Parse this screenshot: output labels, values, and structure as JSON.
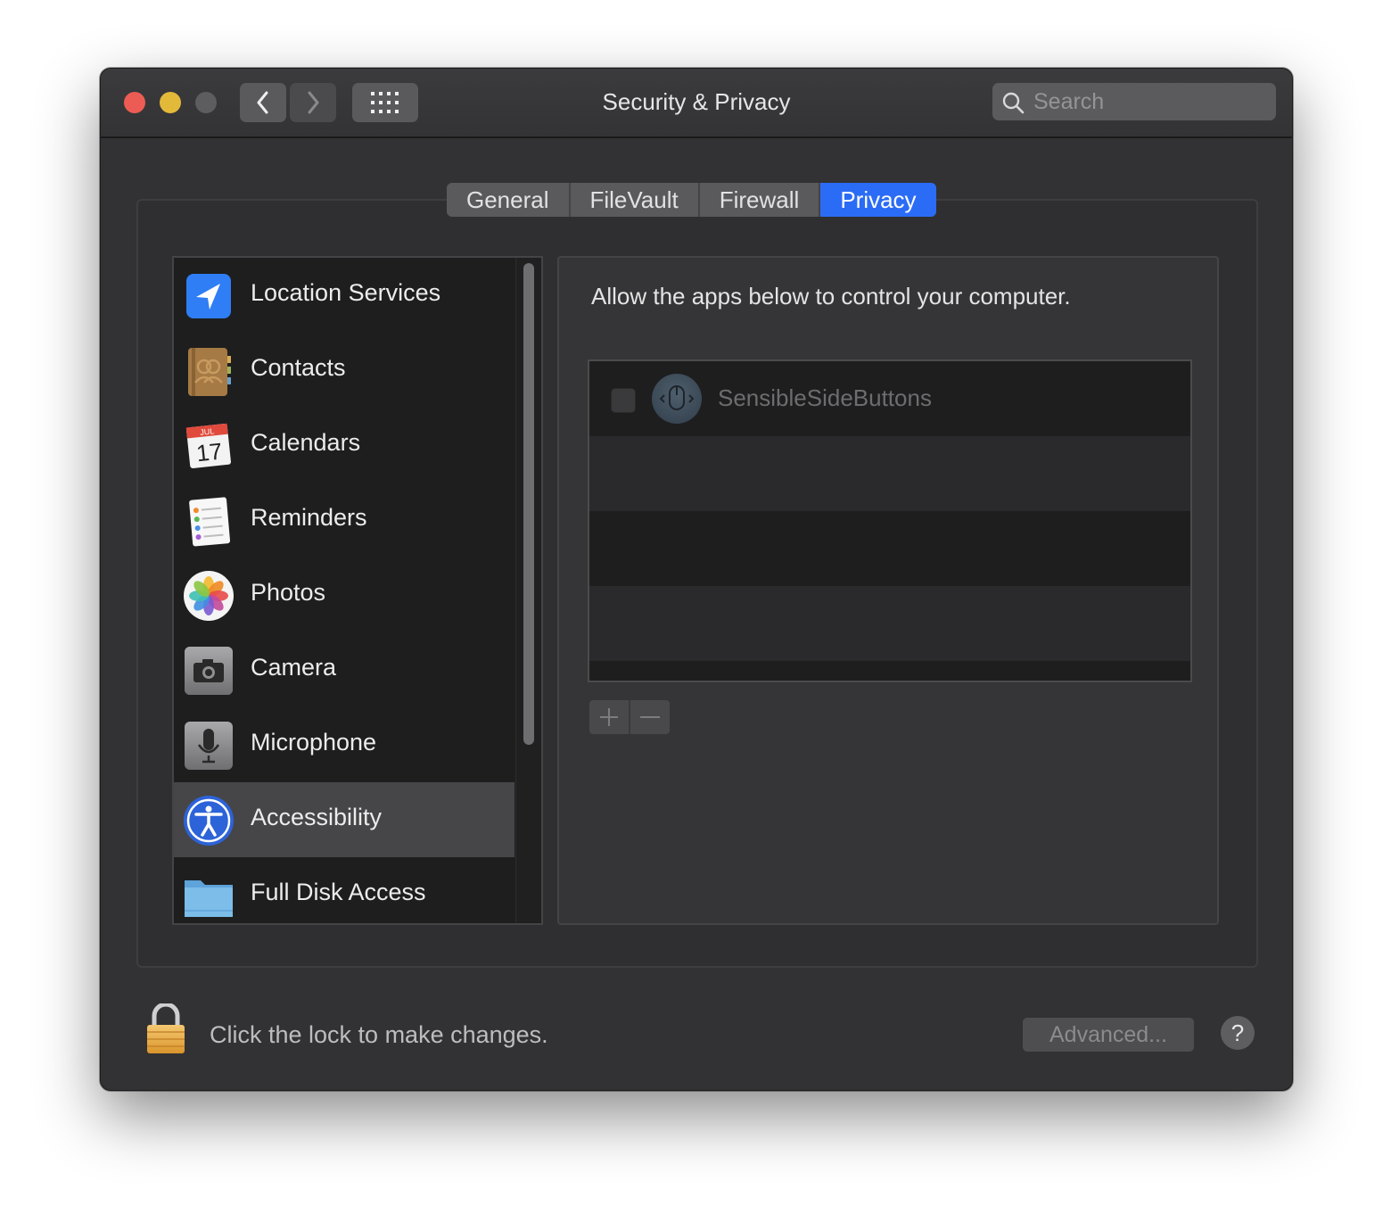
{
  "window": {
    "title": "Security & Privacy"
  },
  "search": {
    "placeholder": "Search"
  },
  "tabs": [
    {
      "label": "General"
    },
    {
      "label": "FileVault"
    },
    {
      "label": "Firewall"
    },
    {
      "label": "Privacy",
      "active": true
    }
  ],
  "sidebar": {
    "items": [
      {
        "label": "Location Services",
        "icon": "location-arrow-icon"
      },
      {
        "label": "Contacts",
        "icon": "contacts-book-icon"
      },
      {
        "label": "Calendars",
        "icon": "calendar-icon",
        "icon_month": "JUL",
        "icon_day": "17"
      },
      {
        "label": "Reminders",
        "icon": "reminders-list-icon"
      },
      {
        "label": "Photos",
        "icon": "photos-flower-icon"
      },
      {
        "label": "Camera",
        "icon": "camera-icon"
      },
      {
        "label": "Microphone",
        "icon": "microphone-icon"
      },
      {
        "label": "Accessibility",
        "icon": "accessibility-icon",
        "selected": true
      },
      {
        "label": "Full Disk Access",
        "icon": "folder-icon"
      }
    ]
  },
  "main": {
    "description": "Allow the apps below to control your computer.",
    "apps": [
      {
        "name": "SensibleSideButtons",
        "checked": false,
        "icon": "mouse-app-icon"
      }
    ],
    "add_symbol": "+",
    "remove_symbol": "−"
  },
  "footer": {
    "lock_text": "Click the lock to make changes.",
    "advanced_label": "Advanced...",
    "help_label": "?"
  },
  "colors": {
    "accent": "#2b6cf6",
    "close": "#ed5c54",
    "minimize": "#e3b93a",
    "zoom_disabled": "#5d5d5f"
  }
}
